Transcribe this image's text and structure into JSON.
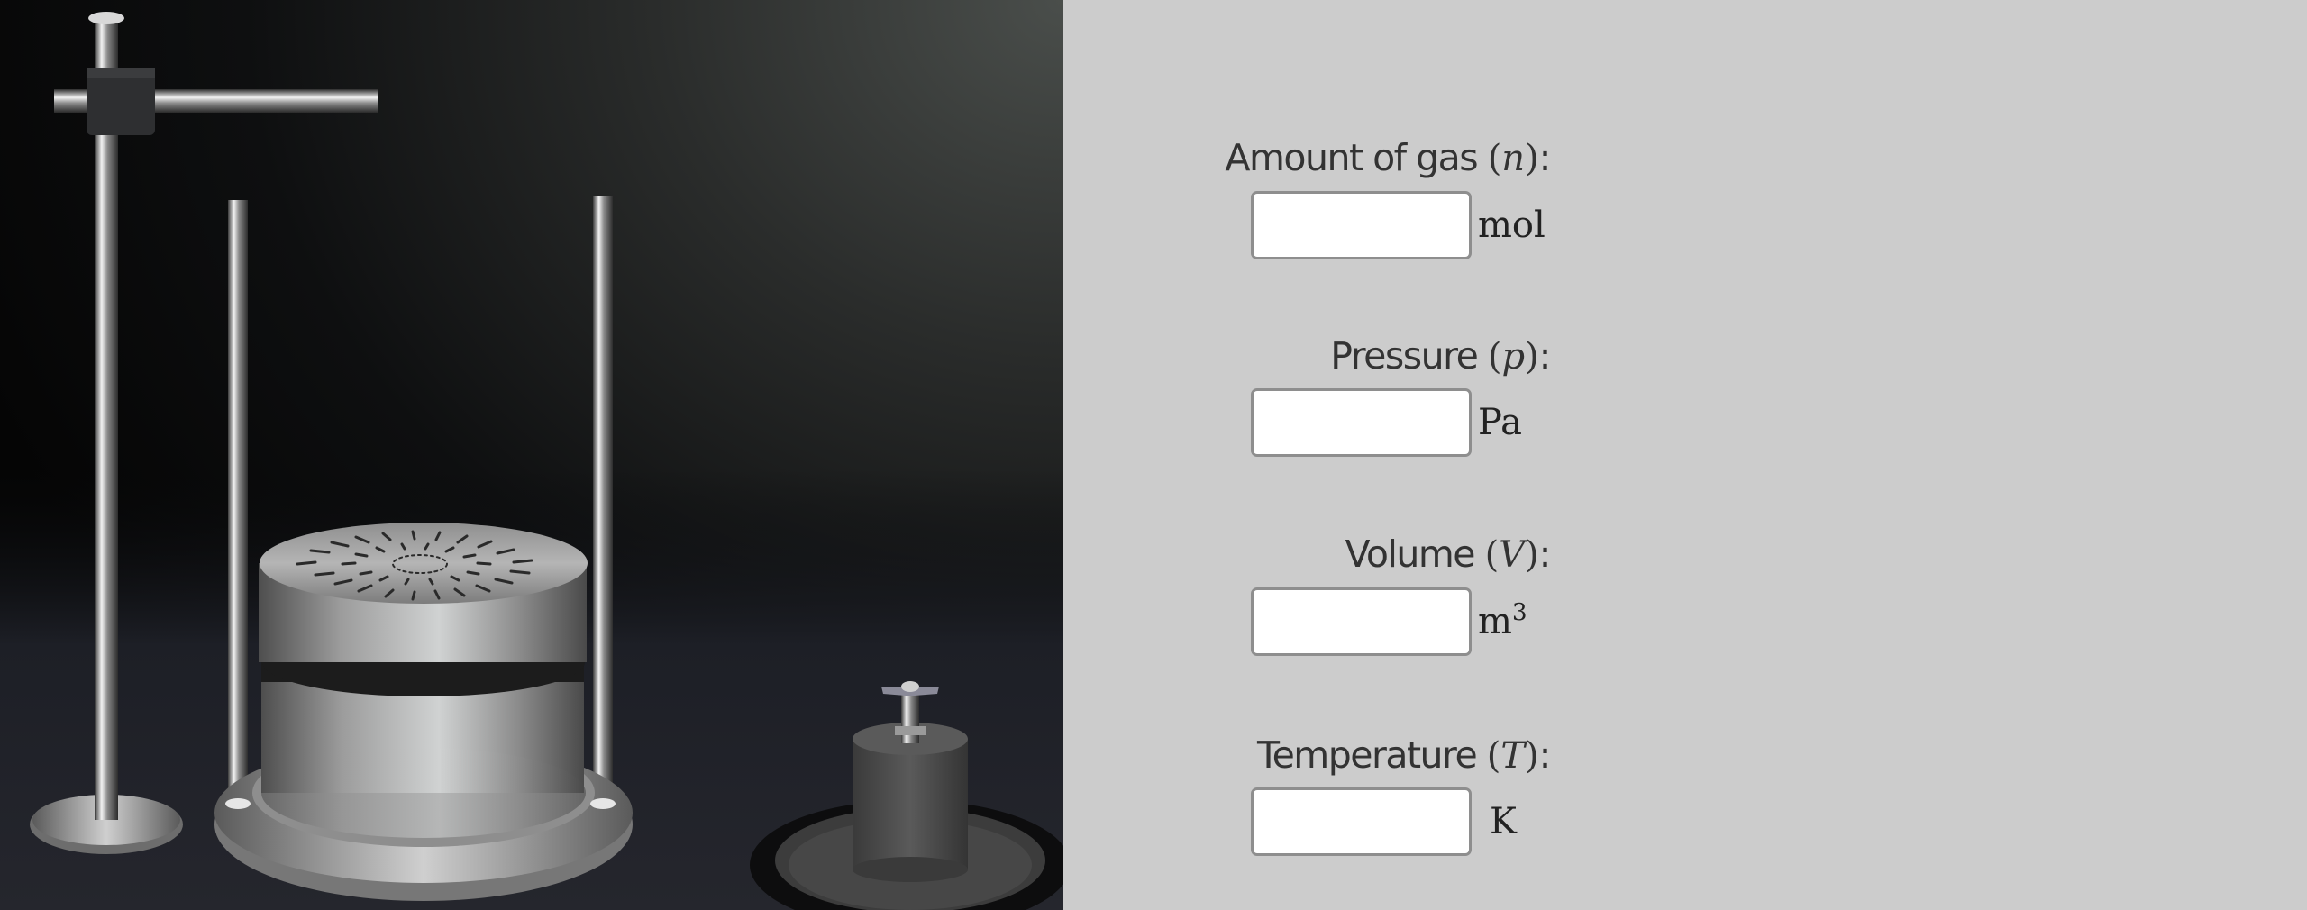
{
  "fields": {
    "amount": {
      "label": "Amount of gas",
      "symbol": "n",
      "unit": "mol",
      "value": ""
    },
    "pressure": {
      "label": "Pressure",
      "symbol": "p",
      "unit": "Pa",
      "value": ""
    },
    "volume": {
      "label": "Volume",
      "symbol": "V",
      "unit": "m",
      "unit_sup": "3",
      "value": ""
    },
    "temperature": {
      "label": "Temperature",
      "symbol": "T",
      "unit": "K",
      "value": ""
    }
  },
  "colors": {
    "panel_bg": "#cccccc",
    "scene_bg": "#1a1b1f",
    "metal": "#c8c8c8",
    "input_border": "#8e8e8e"
  },
  "scene": {
    "objects": [
      "retort-stand",
      "gas-cylinder-apparatus",
      "guide-rods",
      "valve-weight"
    ]
  }
}
